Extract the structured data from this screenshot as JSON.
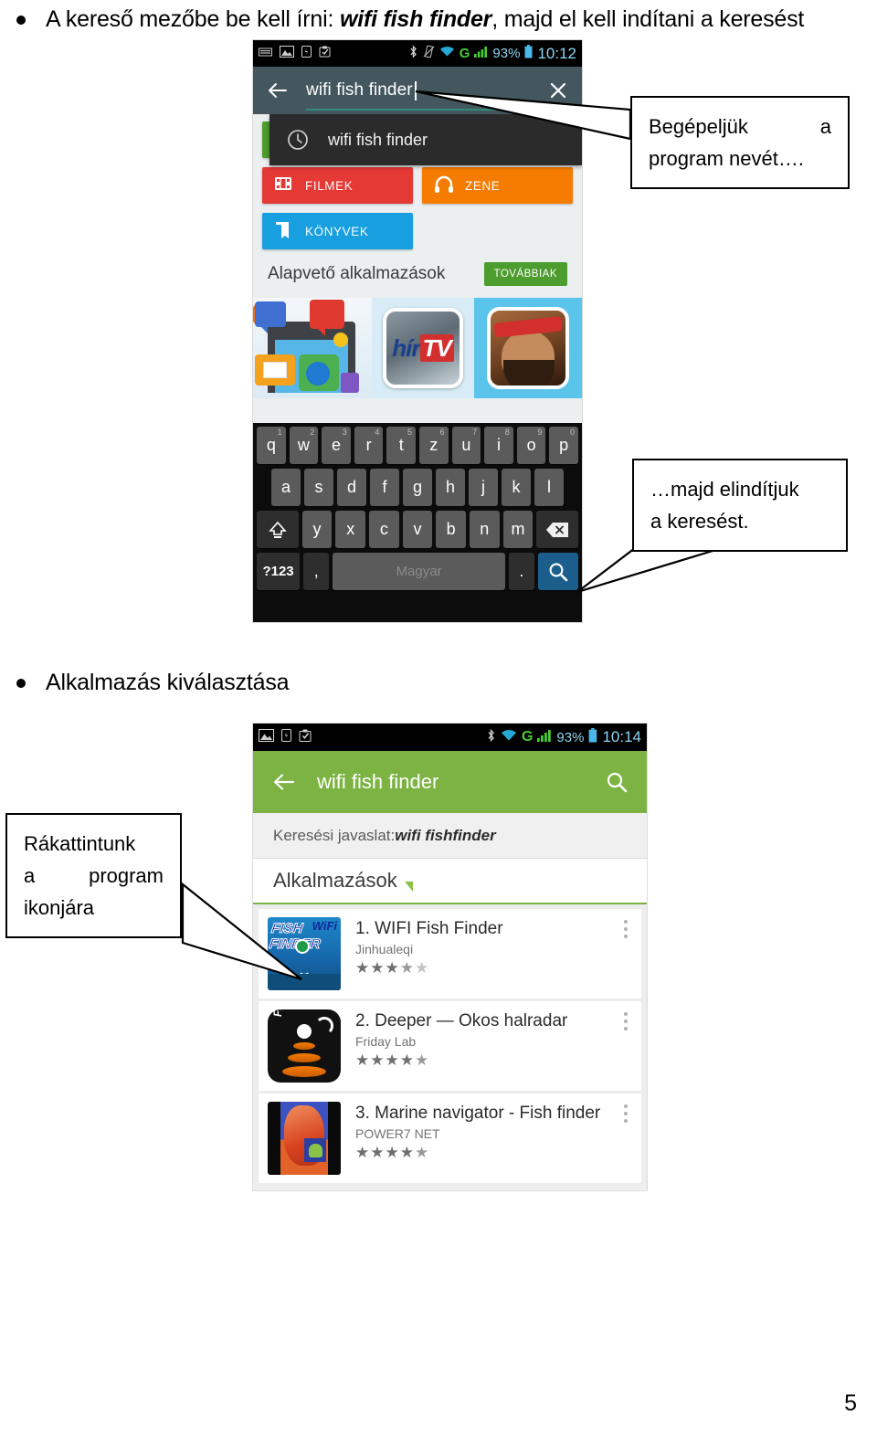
{
  "document": {
    "page_number": "5",
    "headings": [
      {
        "prefix": "A kereső mezőbe be kell írni: ",
        "emphasis": "wifi fish finder",
        "suffix": ", majd el kell indítani a keresést"
      },
      {
        "prefix": "Alkalmazás kiválasztása",
        "emphasis": "",
        "suffix": ""
      }
    ]
  },
  "callouts": [
    {
      "id": "callout-type-name",
      "line1_left": "Begépeljük",
      "line1_right": "a",
      "line2": "program nevét…."
    },
    {
      "id": "callout-start-search",
      "line1": "…majd  elindítjuk",
      "line2": "a keresést."
    },
    {
      "id": "callout-tap-icon",
      "line1": "Rákattintunk",
      "line2_left": "a",
      "line2_right": "program",
      "line3": "ikonjára"
    }
  ],
  "phone1": {
    "status_bar": {
      "left_icons": [
        "keyboard-icon",
        "image-icon",
        "sd-card-icon",
        "clipboard-icon"
      ],
      "right_icons": [
        "bluetooth-icon",
        "vibrate-icon",
        "wifi-icon",
        "gprs-icon",
        "signal-icon",
        "battery-icon"
      ],
      "battery_percent": "93%",
      "time": "10:12"
    },
    "search": {
      "back_icon": "back-arrow-icon",
      "value": "wifi fish finder",
      "clear_icon": "close-x-icon"
    },
    "suggestion": {
      "icon": "history-clock-icon",
      "text": "wifi fish finder"
    },
    "tiles": [
      {
        "label": "",
        "icon": "apps-icon",
        "color": "#4c9c2e",
        "hidden_by_overlay": true
      },
      {
        "label": "FILMEK",
        "icon": "film-icon",
        "color": "#e53935"
      },
      {
        "label": "ZENE",
        "icon": "headphones-icon",
        "color": "#f57c00"
      },
      {
        "label": "KÖNYVEK",
        "icon": "book-icon",
        "color": "#189fe0"
      }
    ],
    "section": {
      "title": "Alapvető alkalmazások",
      "more_button": "TOVÁBBIAK"
    },
    "promo": {
      "items": [
        "messaging-collage",
        "hírTV",
        "boom-beach-character"
      ],
      "hirtv_main": "hír",
      "hirtv_accent": "TV"
    },
    "keyboard": {
      "row1": [
        {
          "key": "q",
          "sup": "1"
        },
        {
          "key": "w",
          "sup": "2"
        },
        {
          "key": "e",
          "sup": "3"
        },
        {
          "key": "r",
          "sup": "4"
        },
        {
          "key": "t",
          "sup": "5"
        },
        {
          "key": "z",
          "sup": "6"
        },
        {
          "key": "u",
          "sup": "7"
        },
        {
          "key": "i",
          "sup": "8"
        },
        {
          "key": "o",
          "sup": "9"
        },
        {
          "key": "p",
          "sup": "0"
        }
      ],
      "row2": [
        "a",
        "s",
        "d",
        "f",
        "g",
        "h",
        "j",
        "k",
        "l"
      ],
      "row3_letters": [
        "y",
        "x",
        "c",
        "v",
        "b",
        "n",
        "m"
      ],
      "shift_icon": "shift-up-icon",
      "delete_icon": "backspace-icon",
      "symbols_key": "?123",
      "comma_key": ",",
      "space_label": "Magyar",
      "period_key": ".",
      "search_icon": "search-magnifier-icon"
    }
  },
  "phone2": {
    "status_bar": {
      "left_icons": [
        "image-icon",
        "sd-card-icon",
        "clipboard-icon"
      ],
      "right_icons": [
        "bluetooth-icon",
        "wifi-icon",
        "gprs-icon",
        "signal-icon",
        "battery-icon"
      ],
      "battery_percent": "93%",
      "time": "10:14"
    },
    "appbar": {
      "back_icon": "back-arrow-icon",
      "title": "wifi fish finder",
      "search_icon": "search-magnifier-icon",
      "color": "#7cb342"
    },
    "suggestion_row": {
      "label": "Keresési javaslat: ",
      "value": "wifi fishfinder"
    },
    "results_header": {
      "title": "Alkalmazások",
      "expand_icon": "expand-corner-icon"
    },
    "results": [
      {
        "name": "1. WIFI Fish Finder",
        "developer": "Jinhualeqi",
        "rating_full": 3,
        "rating_half": true,
        "rating_empty": 1,
        "icon": "wifi-fish-finder-icon",
        "menu_icon": "overflow-menu-icon"
      },
      {
        "name": "2. Deeper — Okos halradar",
        "developer": "Friday Lab",
        "rating_full": 4,
        "rating_half": true,
        "rating_empty": 0,
        "icon": "deeper-fishfinder-icon",
        "menu_icon": "overflow-menu-icon"
      },
      {
        "name": "3. Marine navigator - Fish finder",
        "developer": "POWER7 NET",
        "rating_full": 4,
        "rating_half": true,
        "rating_empty": 0,
        "icon": "marine-navigator-icon",
        "menu_icon": "overflow-menu-icon"
      }
    ]
  },
  "colors": {
    "appbar_green": "#7cb342",
    "search_dark": "#44575e",
    "suggest_dark": "#2b2b2b",
    "tile_red": "#e53935",
    "tile_orange": "#f57c00",
    "tile_blue": "#189fe0",
    "tile_green": "#4c9c2e",
    "key_blue": "#1b5e8c"
  }
}
